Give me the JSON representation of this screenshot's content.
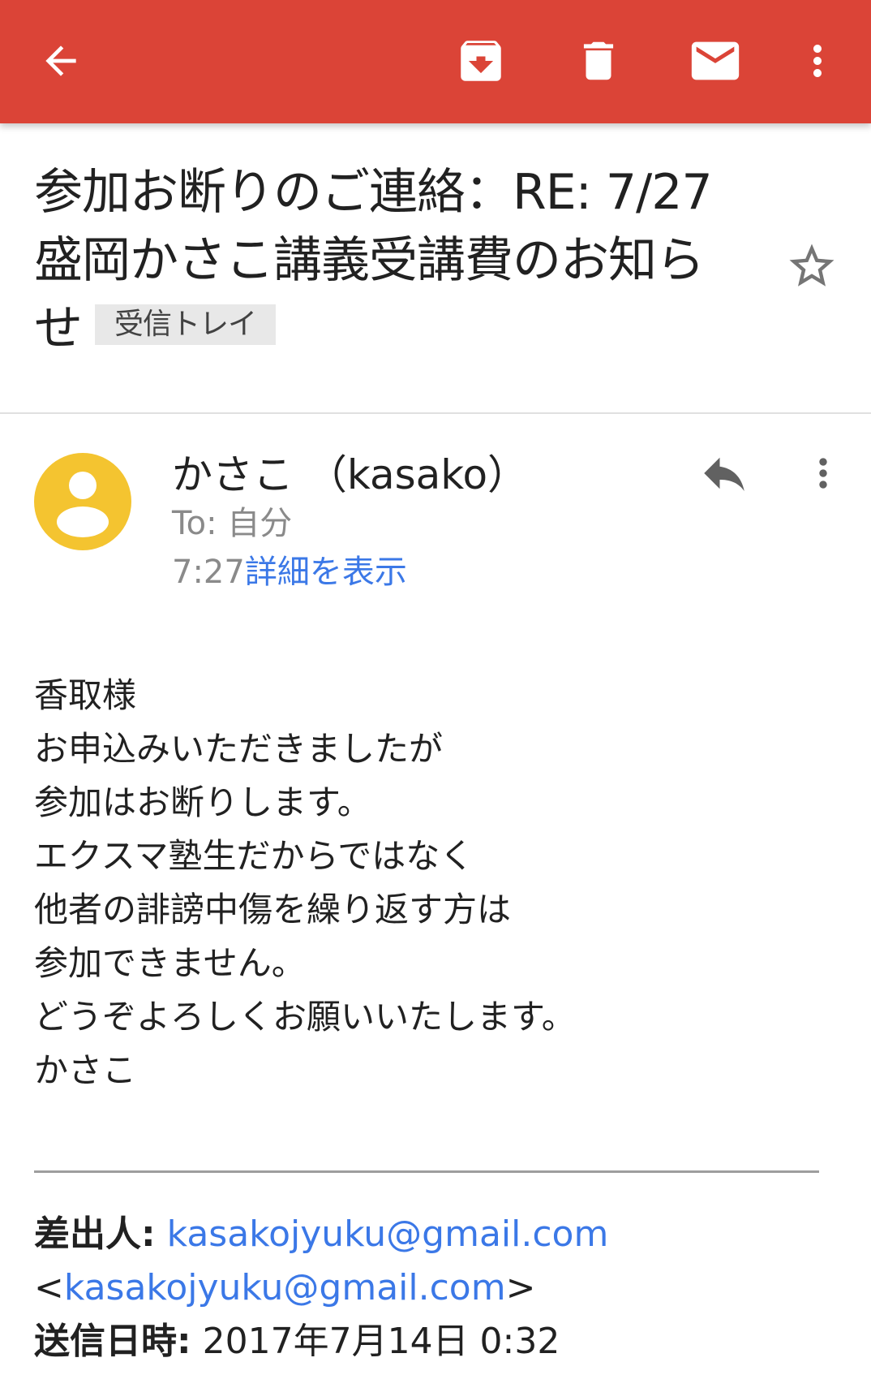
{
  "colors": {
    "appbar": "#db4437",
    "avatar": "#f4c430",
    "link": "#3b78e7",
    "secondary_text": "#8a8a8a"
  },
  "appbar": {
    "icons": [
      "back-arrow-icon",
      "archive-icon",
      "delete-icon",
      "mark-unread-icon",
      "more-vert-icon"
    ]
  },
  "subject": {
    "text": "参加お断りのご連絡：RE: 7/27盛岡かさこ講義受講費のお知らせ",
    "label": "受信トレイ"
  },
  "message": {
    "sender": "かさこ （kasako）",
    "to": "To: 自分",
    "time": "7:27",
    "details_link": "詳細を表示",
    "body_lines": [
      "香取様",
      "お申込みいただきましたが",
      "参加はお断りします。",
      "エクスマ塾生だからではなく",
      "他者の誹謗中傷を繰り返す方は",
      "参加できません。",
      "どうぞよろしくお願いいたします。",
      "かさこ"
    ]
  },
  "quoted_header": {
    "from_label": "差出人:",
    "from_email": "kasakojyuku@gmail.com",
    "from_email_bracket": "kasakojyuku@gmail.com",
    "bracket_open": "<",
    "bracket_close": ">",
    "sent_label": "送信日時:",
    "sent_value": "2017年7月14日 0:32"
  }
}
